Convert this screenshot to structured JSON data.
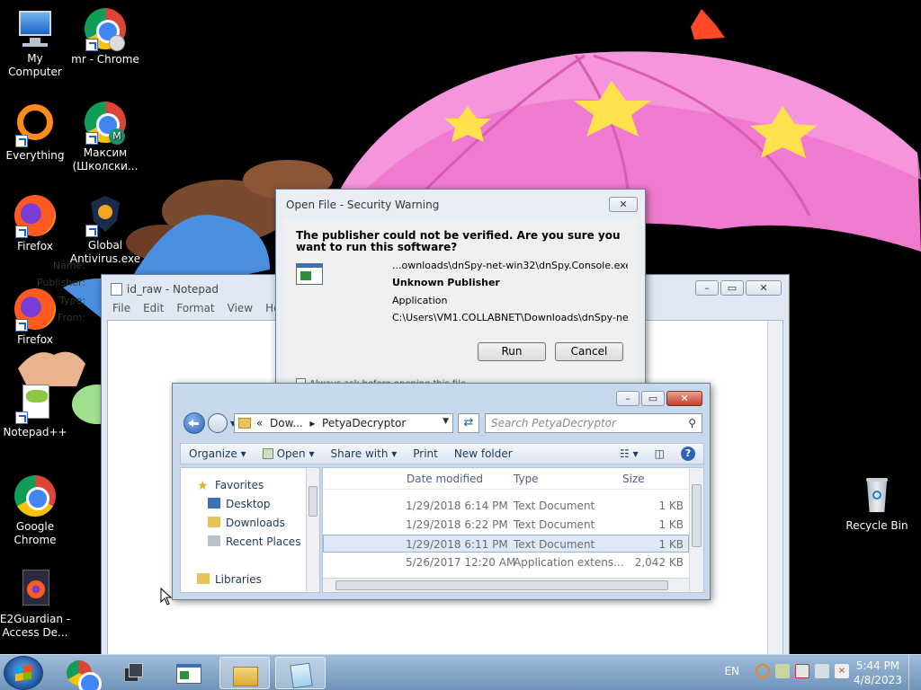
{
  "desktop": {
    "icons": [
      {
        "label": "My Computer"
      },
      {
        "label": "mr - Chrome"
      },
      {
        "label": "Everything"
      },
      {
        "label": "Максим (Школски..."
      },
      {
        "label": "Firefox"
      },
      {
        "label": "Global Antivirus.exe"
      },
      {
        "label": "Firefox"
      },
      {
        "label": "Notepad++"
      },
      {
        "label": "Google Chrome"
      },
      {
        "label": "E2Guardian - Access De..."
      },
      {
        "label": "Recycle Bin"
      }
    ]
  },
  "notepad": {
    "title": "id_raw - Notepad",
    "menu": [
      "File",
      "Edit",
      "Format",
      "View",
      "Help"
    ]
  },
  "security_dialog": {
    "title": "Open File - Security Warning",
    "question": "The publisher could not be verified.  Are you sure you want to run this software?",
    "fields": [
      {
        "label": "Name:",
        "value": "...ownloads\\dnSpy-net-win32\\dnSpy.Console.exe"
      },
      {
        "label": "Publisher:",
        "value": "Unknown Publisher"
      },
      {
        "label": "Type:",
        "value": "Application"
      },
      {
        "label": "From:",
        "value": "C:\\Users\\VM1.COLLABNET\\Downloads\\dnSpy-ne..."
      }
    ],
    "run_label": "Run",
    "cancel_label": "Cancel",
    "partial_checkbox": "Always ask before opening this file"
  },
  "explorer": {
    "address": {
      "chevron": "«",
      "parent": "Dow...",
      "sep": "▸",
      "current": "PetyaDecryptor"
    },
    "search_placeholder": "Search PetyaDecryptor",
    "toolbar": {
      "organize": "Organize",
      "open": "Open",
      "share_with": "Share with",
      "print": "Print",
      "new_folder": "New folder"
    },
    "nav": {
      "favorites": "Favorites",
      "desktop": "Desktop",
      "downloads": "Downloads",
      "recent_places": "Recent Places",
      "libraries": "Libraries"
    },
    "columns": {
      "date": "Date modified",
      "type": "Type",
      "size": "Size"
    },
    "rows": [
      {
        "date": "1/29/2018 6:14 PM",
        "type": "Text Document",
        "size": "1 KB"
      },
      {
        "date": "1/29/2018 6:22 PM",
        "type": "Text Document",
        "size": "1 KB"
      },
      {
        "date": "1/29/2018 6:11 PM",
        "type": "Text Document",
        "size": "1 KB"
      },
      {
        "date": "5/26/2017 12:20 AM",
        "type": "Application extens...",
        "size": "2,042 KB"
      }
    ]
  },
  "taskbar": {
    "language": "EN",
    "time": "5:44 PM",
    "date": "4/8/2023"
  },
  "colors": {
    "desktop_bg": "#000000",
    "umbrella": "#f07ad0",
    "star": "#ffe14d",
    "taskbar": "#7da0c6",
    "close_red": "#c4412c"
  }
}
